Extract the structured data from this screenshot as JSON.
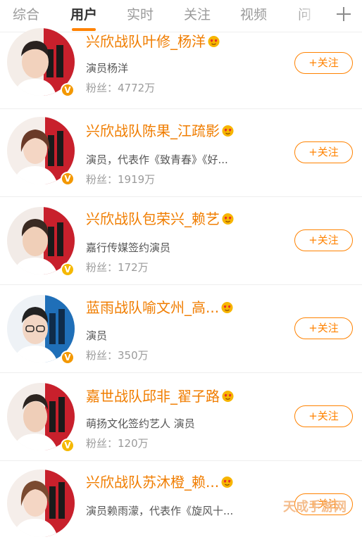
{
  "tabs": [
    {
      "label": "综合"
    },
    {
      "label": "用户"
    },
    {
      "label": "实时"
    },
    {
      "label": "关注"
    },
    {
      "label": "视频"
    },
    {
      "label": "问"
    }
  ],
  "active_tab": "用户",
  "accent_color": "#ff8200",
  "icons": {
    "add": "plus-icon",
    "verified": "v-badge-icon",
    "heart": "heart-emoji-icon"
  },
  "results": [
    {
      "name": "兴欣战队叶修_杨洋",
      "description": "演员杨洋",
      "fans": "粉丝：4772万",
      "follow_label": "+关注",
      "badge": "V",
      "badge_color": "#f39800",
      "avatar_bg": "#c8202c"
    },
    {
      "name": "兴欣战队陈果_江疏影",
      "description": "演员，代表作《致青春》《好...",
      "fans": "粉丝：1919万",
      "follow_label": "+关注",
      "badge": "V",
      "badge_color": "#f39800",
      "avatar_bg": "#c8202c"
    },
    {
      "name": "兴欣战队包荣兴_赖艺",
      "description": "嘉行传媒签约演员",
      "fans": "粉丝：172万",
      "follow_label": "+关注",
      "badge": "V",
      "badge_color": "#f5b800",
      "avatar_bg": "#c8202c"
    },
    {
      "name": "蓝雨战队喻文州_高...",
      "description": "演员",
      "fans": "粉丝：350万",
      "follow_label": "+关注",
      "badge": "V",
      "badge_color": "#f39800",
      "avatar_bg": "#1f6fb8"
    },
    {
      "name": "嘉世战队邱非_翟子路",
      "description": "萌扬文化签约艺人 演员",
      "fans": "粉丝：120万",
      "follow_label": "+关注",
      "badge": "V",
      "badge_color": "#f5b800",
      "avatar_bg": "#c8202c"
    },
    {
      "name": "兴欣战队苏沐橙_赖...",
      "description": "演员赖雨濛，代表作《旋风十...",
      "fans": "",
      "follow_label": "+关注",
      "badge": "",
      "badge_color": "#f39800",
      "avatar_bg": "#c8202c"
    }
  ],
  "watermark": "天成手游网"
}
